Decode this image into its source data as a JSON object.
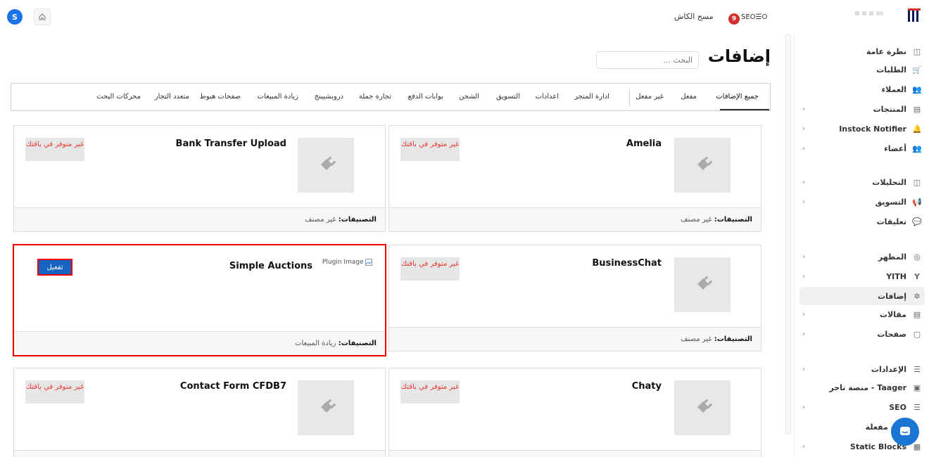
{
  "topbar": {
    "user_initial": "S",
    "clear_cache": "مسح الكاش",
    "seo_badge": "9",
    "seo_label": "SEO☰O"
  },
  "sidebar": {
    "items": [
      {
        "label": "نظرة عامة",
        "icon": "chart-icon",
        "glyph": "◫",
        "chev": false
      },
      {
        "label": "الطلبات",
        "icon": "cart-icon",
        "glyph": "🛒",
        "chev": false
      },
      {
        "label": "العملاء",
        "icon": "users-icon",
        "glyph": "👥",
        "chev": false
      },
      {
        "label": "المنتجات",
        "icon": "box-icon",
        "glyph": "▤",
        "chev": true
      },
      {
        "label": "Instock Notifier",
        "icon": "notifier-icon",
        "glyph": "🔔",
        "chev": true
      },
      {
        "label": "أعضاء",
        "icon": "members-icon",
        "glyph": "👥",
        "chev": true
      },
      {
        "label": "التحليلات",
        "icon": "analytics-icon",
        "glyph": "◫",
        "chev": true
      },
      {
        "label": "التسويق",
        "icon": "megaphone-icon",
        "glyph": "📢",
        "chev": true
      },
      {
        "label": "تعليقات",
        "icon": "comment-icon",
        "glyph": "💬",
        "chev": false
      },
      {
        "label": "المظهر",
        "icon": "palette-icon",
        "glyph": "◎",
        "chev": true
      },
      {
        "label": "YITH",
        "icon": "yith-icon",
        "glyph": "Y",
        "chev": true
      },
      {
        "label": "إضافات",
        "icon": "plugin-icon",
        "glyph": "✲",
        "chev": false
      },
      {
        "label": "مقالات",
        "icon": "article-icon",
        "glyph": "▤",
        "chev": true
      },
      {
        "label": "صفحات",
        "icon": "page-icon",
        "glyph": "▢",
        "chev": true
      },
      {
        "label": "الإعدادات",
        "icon": "settings-icon",
        "glyph": "☰",
        "chev": true
      },
      {
        "label": "Taager - منصة تاجر",
        "icon": "taager-icon",
        "glyph": "▣",
        "chev": false
      },
      {
        "label": "SEO",
        "icon": "seo-icon",
        "glyph": "☰",
        "chev": true
      },
      {
        "label": "فات مفعلة",
        "icon": "active-plugins-icon",
        "glyph": "",
        "chev": false
      },
      {
        "label": "Static Blocks",
        "icon": "blocks-icon",
        "glyph": "▦",
        "chev": true
      }
    ]
  },
  "main": {
    "title": "إضافات",
    "search_placeholder": "البحث ...",
    "tabs": [
      "جميع الإضافات",
      "مفعل",
      "غير مفعل",
      "ادارة المتجر",
      "اعدادات",
      "التسويق",
      "الشحن",
      "بوابات الدفع",
      "تجارة جملة",
      "دروبشيبنج",
      "زيادة المبيعات",
      "صفحات هبوط",
      "متعدد التجار",
      "محركات البحث"
    ],
    "categories_label": "التصنيفات:",
    "unavailable": "غير متوفر في باقتك",
    "activate": "تفعيل",
    "plugin_image": "Plugin Image",
    "cards": [
      {
        "title": "Amelia",
        "category": "غير مصنف"
      },
      {
        "title": "Bank Transfer Upload",
        "category": "غير مصنف"
      },
      {
        "title": "BusinessChat",
        "category": "غير مصنف"
      },
      {
        "title": "Simple Auctions",
        "category": "زيادة المبيعات"
      },
      {
        "title": "Chaty",
        "category": ""
      },
      {
        "title": "Contact Form CFDB7",
        "category": ""
      }
    ]
  }
}
